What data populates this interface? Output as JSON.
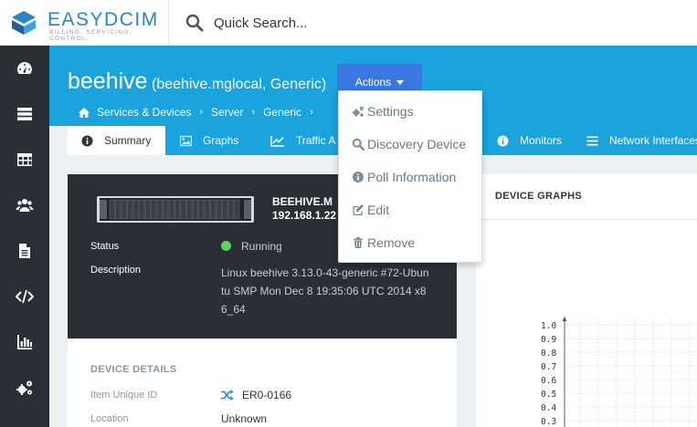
{
  "brand": {
    "name": "EASYDCIM",
    "tagline": "BILLING. SERVICING. CONTROL."
  },
  "search": {
    "placeholder": "Quick Search..."
  },
  "sidebar": {
    "items": [
      {
        "icon": "dashboard-icon"
      },
      {
        "icon": "servers-icon"
      },
      {
        "icon": "table-icon"
      },
      {
        "icon": "users-icon"
      },
      {
        "icon": "document-icon"
      },
      {
        "icon": "code-icon"
      },
      {
        "icon": "bar-chart-icon"
      },
      {
        "icon": "cogs-icon"
      }
    ]
  },
  "device": {
    "title": "beehive",
    "subtitle": "(beehive.mglocal, Generic)",
    "name_line1": "BEEHIVE.M",
    "name_line2": "192.168.1.22"
  },
  "actions": {
    "label": "Actions",
    "menu": [
      {
        "label": "Settings",
        "icon": "cogs-icon"
      },
      {
        "label": "Discovery Device",
        "icon": "search-icon"
      },
      {
        "label": "Poll Information",
        "icon": "info-icon"
      },
      {
        "label": "Edit",
        "icon": "edit-icon"
      },
      {
        "label": "Remove",
        "icon": "trash-icon"
      }
    ]
  },
  "breadcrumb": [
    "Services & Devices",
    "Server",
    "Generic",
    "›"
  ],
  "tabs": [
    {
      "label": "Summary",
      "icon": "info-icon",
      "active": true
    },
    {
      "label": "Graphs",
      "icon": "image-icon"
    },
    {
      "label": "Traffic A",
      "icon": "line-chart-icon"
    },
    {
      "label": "Monitors",
      "icon": "info-icon"
    },
    {
      "label": "Network Interfaces",
      "icon": "list-icon"
    }
  ],
  "summary": {
    "status_label": "Status",
    "status_value": "Running",
    "status_color": "#5cd15c",
    "description_label": "Description",
    "description_value": "Linux beehive 3.13.0-43-generic #72-Ubuntu SMP Mon Dec 8 19:35:06 UTC 2014 x86_64"
  },
  "details": {
    "title": "DEVICE DETAILS",
    "unique_id_label": "Item Unique ID",
    "unique_id_value": "ER0-0166",
    "location_label": "Location",
    "location_value": "Unknown"
  },
  "graphs": {
    "title": "DEVICE GRAPHS",
    "y_ticks": [
      "1.0",
      "0.9",
      "0.8",
      "0.7",
      "0.6",
      "0.5",
      "0.4",
      "0.3"
    ]
  },
  "colors": {
    "accent": "#1aa3dc",
    "actions": "#3b79e0",
    "sidebar": "#2a2f36"
  }
}
